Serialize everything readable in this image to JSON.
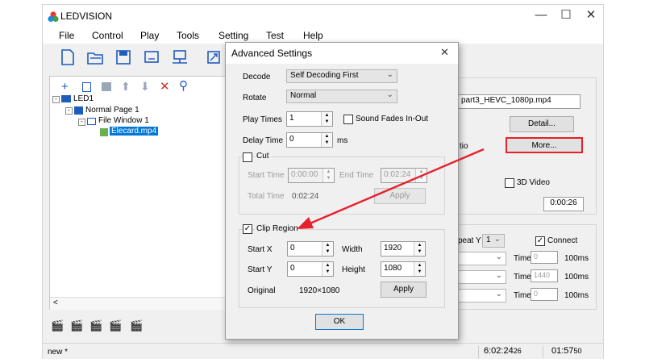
{
  "app": {
    "title": "LEDVISION"
  },
  "menu": [
    "File",
    "Control",
    "Play",
    "Tools",
    "Setting",
    "Test",
    "Help"
  ],
  "tree": {
    "led": "LED1",
    "page": "Normal Page 1",
    "window": "File Window 1",
    "file": "Elecard.mp4"
  },
  "right": {
    "filename": "part3_HEVC_1080p.mp4",
    "detail_label": "Detail...",
    "ratio_label": "tio",
    "more_label": "More...",
    "video3d_label": "3D Video",
    "duration": "0:00:26",
    "repeat_label": "peat Y",
    "repeat_value": "1",
    "connect_label": "Connect",
    "time_label": "Time",
    "time_values": [
      "0",
      "1440",
      "0"
    ],
    "unit": "100ms"
  },
  "dialog": {
    "title": "Advanced Settings",
    "decode_label": "Decode",
    "decode_value": "Self Decoding First",
    "rotate_label": "Rotate",
    "rotate_value": "Normal",
    "playtimes_label": "Play Times",
    "playtimes_value": "1",
    "fade_label": "Sound Fades In-Out",
    "delay_label": "Delay Time",
    "delay_value": "0",
    "delay_unit": "ms",
    "cut_label": "Cut",
    "start_time_label": "Start Time",
    "start_time_value": "0:00:00",
    "end_time_label": "End Time",
    "end_time_value": "0:02:24",
    "total_time_label": "Total Time",
    "total_time_value": "0:02:24",
    "cut_apply": "Apply",
    "clip_label": "Clip Region",
    "startx_label": "Start X",
    "startx_value": "0",
    "width_label": "Width",
    "width_value": "1920",
    "starty_label": "Start Y",
    "starty_value": "0",
    "height_label": "Height",
    "height_value": "1080",
    "original_label": "Original",
    "original_value": "1920×1080",
    "clip_apply": "Apply",
    "ok_label": "OK"
  },
  "status": {
    "left": "new *",
    "time1": "6:02:24",
    "time1_small": "26",
    "time2": "01:57",
    "time2_small": "50"
  },
  "colors": {
    "annotation": "#e8202a",
    "selected": "#0078d7",
    "accent": "#1e5bbf"
  }
}
